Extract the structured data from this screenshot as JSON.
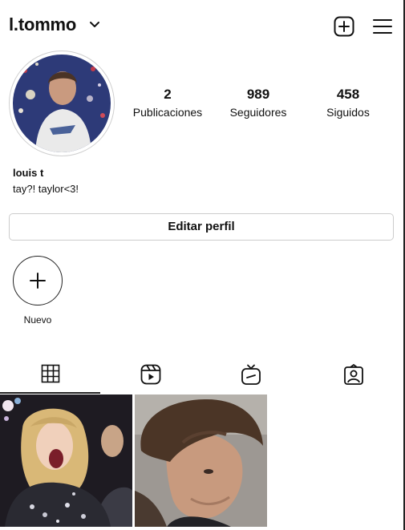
{
  "header": {
    "username": "l.tommo",
    "icons": {
      "dropdown": "chevron-down-icon",
      "new_post": "plus-square-icon",
      "menu": "hamburger-menu-icon"
    }
  },
  "profile": {
    "stats": [
      {
        "value": "2",
        "label": "Publicaciones"
      },
      {
        "value": "989",
        "label": "Seguidores"
      },
      {
        "value": "458",
        "label": "Siguidos"
      }
    ],
    "name": "louis t",
    "bio": "tay?! taylor<3!",
    "edit_button": "Editar perfil"
  },
  "highlights": [
    {
      "label": "Nuevo",
      "icon": "plus-icon"
    }
  ],
  "tabs": [
    {
      "icon": "grid-icon",
      "active": true
    },
    {
      "icon": "reels-icon",
      "active": false
    },
    {
      "icon": "igtv-icon",
      "active": false
    },
    {
      "icon": "tagged-icon",
      "active": false
    }
  ],
  "posts": [
    {
      "description_icon": "photo-post"
    },
    {
      "description_icon": "photo-post"
    }
  ],
  "colors": {
    "text": "#111111",
    "border": "#cccccc",
    "background": "#ffffff"
  }
}
